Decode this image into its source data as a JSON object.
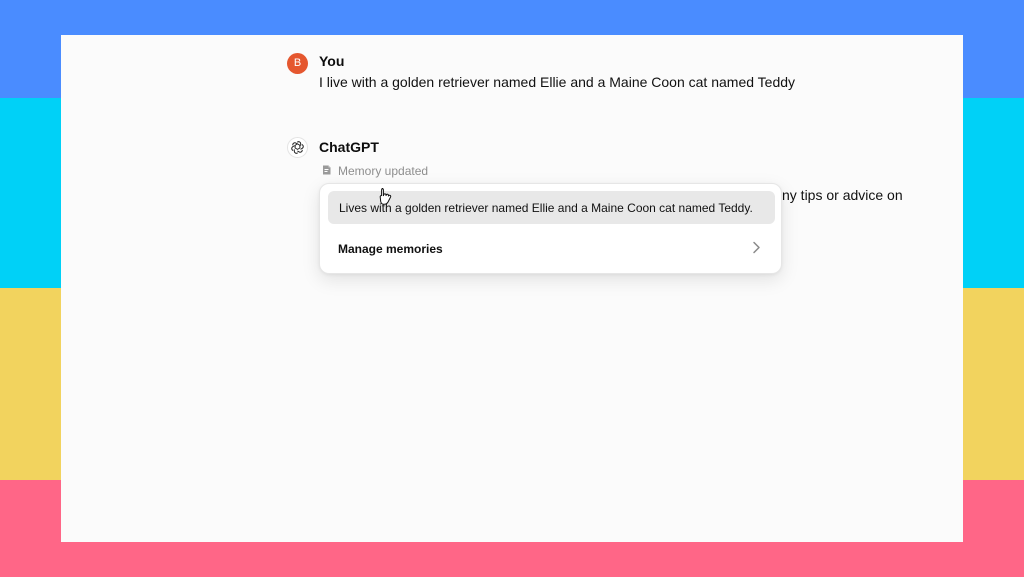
{
  "conversation": {
    "user": {
      "avatar_initial": "B",
      "name": "You",
      "message": "I live with a golden retriever named Ellie and a Maine Coon cat named Teddy"
    },
    "assistant": {
      "name": "ChatGPT",
      "memory_status": "Memory updated",
      "response_fragment": "ny tips or advice on"
    }
  },
  "memory_popover": {
    "memory_text": "Lives with a golden retriever named Ellie and a Maine Coon cat named Teddy.",
    "manage_label": "Manage memories"
  },
  "colors": {
    "background_blue": "#4a8cff",
    "background_cyan": "#00d1f7",
    "background_yellow": "#f2d35e",
    "background_pink": "#ff6687",
    "avatar": "#e5572f",
    "surface": "#fbfbfb"
  },
  "icons": {
    "assistant_logo": "chatgpt-logo-icon",
    "memory_status": "memory-icon",
    "manage_arrow": "chevron-right-icon",
    "pointer": "hand-pointer-icon"
  }
}
